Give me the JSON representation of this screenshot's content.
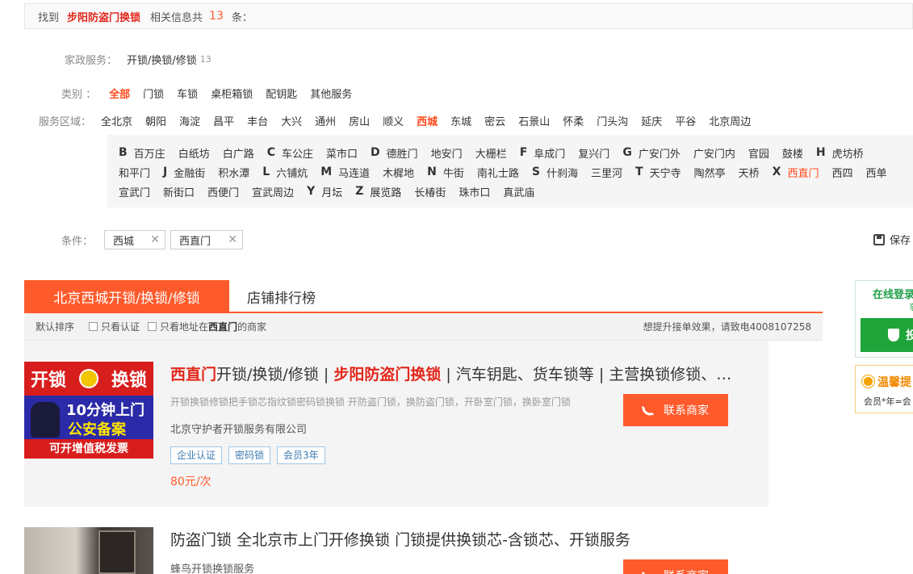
{
  "found_bar": {
    "prefix": "找到",
    "keyword": "步阳防盗门换锁",
    "mid": "相关信息共",
    "count": "13",
    "suffix": "条："
  },
  "category_path": {
    "label": "家政服务：",
    "value": "开锁/换锁/修锁",
    "count": "13"
  },
  "type_filter": {
    "label": "类别 ：",
    "options": [
      "全部",
      "门锁",
      "车锁",
      "桌柜箱锁",
      "配钥匙",
      "其他服务"
    ],
    "selected": "全部"
  },
  "area_filter": {
    "label": "服务区域：",
    "options": [
      "全北京",
      "朝阳",
      "海淀",
      "昌平",
      "丰台",
      "大兴",
      "通州",
      "房山",
      "顺义",
      "西城",
      "东城",
      "密云",
      "石景山",
      "怀柔",
      "门头沟",
      "延庆",
      "平谷",
      "北京周边"
    ],
    "selected": "西城"
  },
  "sub_areas": {
    "line1": [
      {
        "letter": "B",
        "items": [
          "百万庄",
          "白纸坊",
          "白广路"
        ]
      },
      {
        "letter": "C",
        "items": [
          "车公庄",
          "菜市口"
        ]
      },
      {
        "letter": "D",
        "items": [
          "德胜门",
          "地安门",
          "大栅栏"
        ]
      },
      {
        "letter": "F",
        "items": [
          "阜成门",
          "复兴门"
        ]
      },
      {
        "letter": "G",
        "items": [
          "广安门外",
          "广安门内",
          "官园",
          "鼓楼"
        ]
      },
      {
        "letter": "H",
        "items": [
          "虎坊桥"
        ]
      }
    ],
    "line2": [
      {
        "letter": "",
        "items": [
          "和平门"
        ]
      },
      {
        "letter": "J",
        "items": [
          "金融街",
          "积水潭"
        ]
      },
      {
        "letter": "L",
        "items": [
          "六铺炕"
        ]
      },
      {
        "letter": "M",
        "items": [
          "马连道",
          "木樨地"
        ]
      },
      {
        "letter": "N",
        "items": [
          "牛街",
          "南礼士路"
        ]
      },
      {
        "letter": "S",
        "items": [
          "什刹海",
          "三里河"
        ]
      },
      {
        "letter": "T",
        "items": [
          "天宁寺",
          "陶然亭",
          "天桥"
        ]
      },
      {
        "letter": "X",
        "items": [
          "西直门",
          "西四",
          "西单"
        ]
      }
    ],
    "line3": [
      {
        "letter": "",
        "items": [
          "宣武门",
          "新街口",
          "西便门",
          "宣武周边"
        ]
      },
      {
        "letter": "Y",
        "items": [
          "月坛"
        ]
      },
      {
        "letter": "Z",
        "items": [
          "展览路",
          "长椿街",
          "珠市口",
          "真武庙"
        ]
      }
    ],
    "selected": "西直门"
  },
  "conditions": {
    "label": "条件：",
    "tags": [
      "西城",
      "西直门"
    ],
    "save_label": "保存"
  },
  "tabs": {
    "active": "北京西城开锁/换锁/修锁",
    "second": "店铺排行榜"
  },
  "sort_bar": {
    "default_sort": "默认排序",
    "only_certified": "只看认证",
    "only_address_prefix": "只看地址在",
    "only_address_place": "西直门",
    "only_address_suffix": "的商家",
    "promo": "想提升接单效果，请致电4008107258"
  },
  "listings": [
    {
      "title_hl1": "西直门",
      "title_mid": "开锁/换锁/修锁 | ",
      "title_hl2": "步阳防盗门换锁",
      "title_rest": " | 汽车钥匙、货车锁等 | 主营换锁修锁、…",
      "desc": "开锁换锁修锁把手锁芯指纹锁密码锁换锁 开防盗门锁，换防盗门锁，开卧室门锁，换卧室门锁",
      "company": "北京守护者开锁服务有限公司",
      "tags": [
        "企业认证",
        "密码锁",
        "会员3年"
      ],
      "price": "80元/次",
      "contact": "联系商家",
      "thumb": {
        "line1_left": "开锁",
        "line1_right": "换锁",
        "line2": "10分钟上门",
        "line3": "公安备案",
        "line4": "可开增值税发票"
      }
    },
    {
      "title": "防盗门锁 全北京市上门开修换锁 门锁提供换锁芯-含锁芯、开锁服务",
      "company": "蜂鸟开锁换锁服务",
      "contact": "联系商家"
    }
  ],
  "side": {
    "online_title": "在线登录",
    "online_sub": "享",
    "online_btn": "投",
    "warm_title": "温馨提",
    "warm_text": "会员*年=会"
  },
  "colors": {
    "accent": "#ff5a2b",
    "highlight": "#e3271b",
    "green": "#1fa53a"
  }
}
